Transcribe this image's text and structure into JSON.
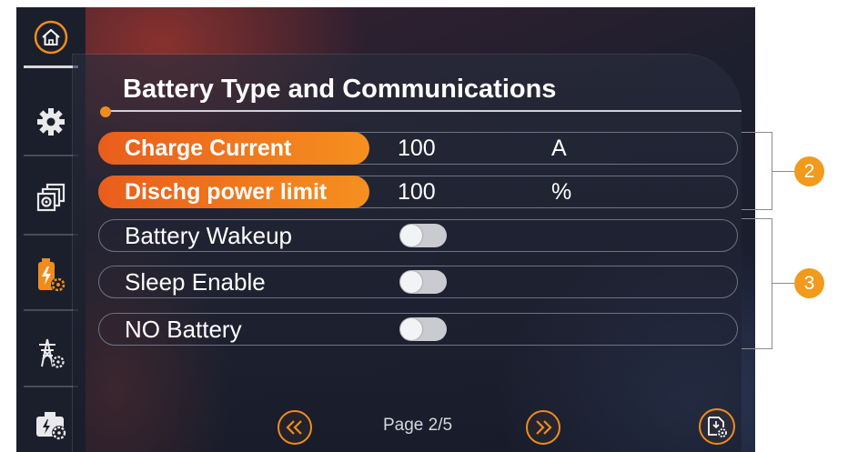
{
  "title": "Battery Type and Communications",
  "rows": [
    {
      "label": "Charge Current",
      "value": "100",
      "unit": "A"
    },
    {
      "label": "Dischg power limit",
      "value": "100",
      "unit": "%"
    },
    {
      "label": "Battery Wakeup",
      "toggle_on": false
    },
    {
      "label": "Sleep Enable",
      "toggle_on": false
    },
    {
      "label": "NO Battery",
      "toggle_on": false
    }
  ],
  "callouts": [
    "2",
    "3"
  ],
  "pagination": {
    "text": "Page 2/5"
  },
  "sidebar": {
    "icons": [
      "home-icon",
      "settings-gear-icon",
      "system-settings-icon",
      "battery-settings-icon",
      "grid-settings-icon",
      "generator-settings-icon"
    ]
  },
  "colors": {
    "accent": "#f08c1e",
    "callout": "#f29a1d",
    "background": "#1b1f2b"
  }
}
